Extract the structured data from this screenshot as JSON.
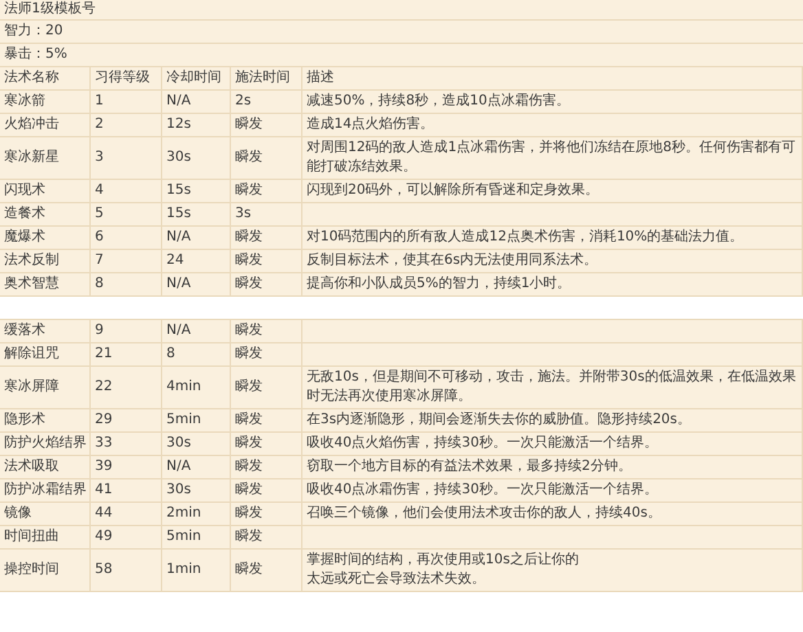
{
  "title": "法师1级模板号",
  "stats": [
    "智力：20",
    "暴击：5%"
  ],
  "columns": [
    "法术名称",
    "习得等级",
    "冷却时间",
    "施法时间",
    "描述"
  ],
  "sections": [
    {
      "rows": [
        {
          "name": "寒冰箭",
          "level": "1",
          "cooldown": "N/A",
          "cast": "2s",
          "description": [
            "减速50%，持续8秒，造成10点冰霜伤害。"
          ]
        },
        {
          "name": "火焰冲击",
          "level": "2",
          "cooldown": "12s",
          "cast": "瞬发",
          "description": [
            "造成14点火焰伤害。"
          ]
        },
        {
          "name": "寒冰新星",
          "level": "3",
          "cooldown": "30s",
          "cast": "瞬发",
          "description": [
            "对周围12码的敌人造成1点冰霜伤害，并将他们冻结在原地8秒。任何伤害都有可能打破冻结效果。"
          ]
        },
        {
          "name": "闪现术",
          "level": "4",
          "cooldown": "15s",
          "cast": "瞬发",
          "description": [
            "闪现到20码外，可以解除所有昏迷和定身效果。"
          ]
        },
        {
          "name": "造餐术",
          "level": "5",
          "cooldown": "15s",
          "cast": "3s",
          "description": []
        },
        {
          "name": "魔爆术",
          "level": "6",
          "cooldown": "N/A",
          "cast": "瞬发",
          "description": [
            "对10码范围内的所有敌人造成12点奥术伤害，消耗10%的基础法力值。"
          ]
        },
        {
          "name": "法术反制",
          "level": "7",
          "cooldown": "24",
          "cast": "瞬发",
          "description": [
            "反制目标法术，使其在6s内无法使用同系法术。"
          ]
        },
        {
          "name": "奥术智慧",
          "level": "8",
          "cooldown": "N/A",
          "cast": "瞬发",
          "description": [
            "提高你和小队成员5%的智力，持续1小时。"
          ]
        }
      ]
    },
    {
      "rows": [
        {
          "name": "缓落术",
          "level": "9",
          "cooldown": "N/A",
          "cast": "瞬发",
          "description": []
        },
        {
          "name": "解除诅咒",
          "level": "21",
          "cooldown": "8",
          "cast": "瞬发",
          "description": []
        },
        {
          "name": "寒冰屏障",
          "level": "22",
          "cooldown": "4min",
          "cast": "瞬发",
          "description": [
            "无敌10s，但是期间不可移动，攻击，施法。并附带30s的低温效果，在低温效果时无法再次使用寒冰屏障。"
          ]
        },
        {
          "name": "隐形术",
          "level": "29",
          "cooldown": "5min",
          "cast": "瞬发",
          "description": [
            "在3s内逐渐隐形，期间会逐渐失去你的威胁值。隐形持续20s。"
          ]
        },
        {
          "name": "防护火焰结界",
          "level": "33",
          "cooldown": "30s",
          "cast": "瞬发",
          "description": [
            "吸收40点火焰伤害，持续30秒。一次只能激活一个结界。"
          ]
        },
        {
          "name": "法术吸取",
          "level": "39",
          "cooldown": "N/A",
          "cast": "瞬发",
          "description": [
            "窃取一个地方目标的有益法术效果，最多持续2分钟。"
          ]
        },
        {
          "name": "防护冰霜结界",
          "level": "41",
          "cooldown": "30s",
          "cast": "瞬发",
          "description": [
            "吸收40点冰霜伤害，持续30秒。一次只能激活一个结界。"
          ]
        },
        {
          "name": "镜像",
          "level": "44",
          "cooldown": "2min",
          "cast": "瞬发",
          "description": [
            "召唤三个镜像，他们会使用法术攻击你的敌人，持续40s。"
          ]
        },
        {
          "name": "时间扭曲",
          "level": "49",
          "cooldown": "5min",
          "cast": "瞬发",
          "description": []
        },
        {
          "name": "操控时间",
          "level": "58",
          "cooldown": "1min",
          "cast": "瞬发",
          "description": [
            "掌握时间的结构，再次使用或10s之后让你的",
            "太远或死亡会导致法术失效。"
          ]
        }
      ]
    }
  ]
}
